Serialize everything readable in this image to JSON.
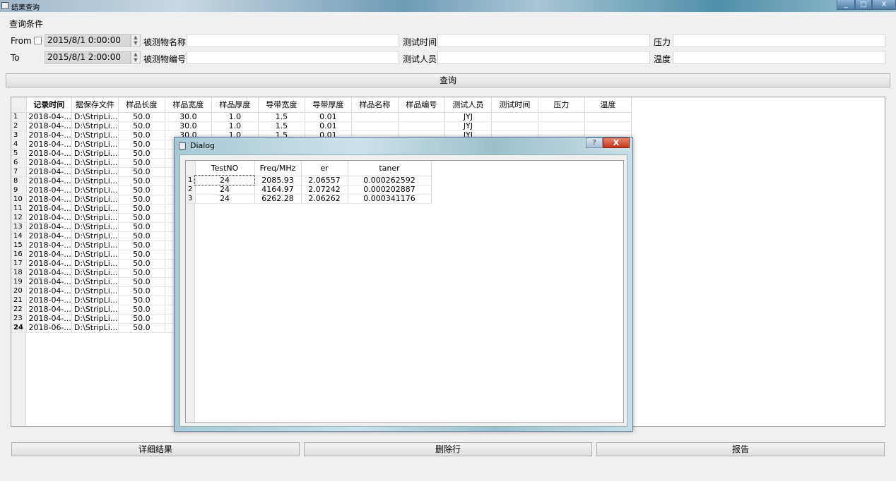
{
  "window": {
    "title": "结果查询",
    "min": "_",
    "max": "□",
    "close": "X"
  },
  "query": {
    "group_label": "查询条件",
    "from_label": "From",
    "to_label": "To",
    "from_value": "2015/8/1 0:00:00",
    "to_value": "2015/8/1 2:00:00",
    "name_label": "被测物名称",
    "id_label": "被测物编号",
    "time_label": "测试时间",
    "tester_label": "测试人员",
    "pressure_label": "压力",
    "temp_label": "温度",
    "search_button": "查询"
  },
  "table": {
    "headers": [
      "记录时间",
      "据保存文件",
      "样品长度",
      "样品宽度",
      "样品厚度",
      "导带宽度",
      "导带厚度",
      "样品名称",
      "样品编号",
      "测试人员",
      "测试时间",
      "压力",
      "温度"
    ],
    "rows": [
      {
        "n": "1",
        "time": "2018-04-...",
        "file": "D:\\StripLi...",
        "len": "50.0",
        "wid": "30.0",
        "thk": "1.0",
        "bw": "1.5",
        "bt": "0.01",
        "tester": "JYJ"
      },
      {
        "n": "2",
        "time": "2018-04-...",
        "file": "D:\\StripLi...",
        "len": "50.0",
        "wid": "30.0",
        "thk": "1.0",
        "bw": "1.5",
        "bt": "0.01",
        "tester": "JYJ"
      },
      {
        "n": "3",
        "time": "2018-04-...",
        "file": "D:\\StripLi...",
        "len": "50.0",
        "wid": "30.0",
        "thk": "1.0",
        "bw": "1.5",
        "bt": "0.01",
        "tester": "JYJ"
      },
      {
        "n": "4",
        "time": "2018-04-...",
        "file": "D:\\StripLi...",
        "len": "50.0"
      },
      {
        "n": "5",
        "time": "2018-04-...",
        "file": "D:\\StripLi...",
        "len": "50.0"
      },
      {
        "n": "6",
        "time": "2018-04-...",
        "file": "D:\\StripLi...",
        "len": "50.0"
      },
      {
        "n": "7",
        "time": "2018-04-...",
        "file": "D:\\StripLi...",
        "len": "50.0"
      },
      {
        "n": "8",
        "time": "2018-04-...",
        "file": "D:\\StripLi...",
        "len": "50.0"
      },
      {
        "n": "9",
        "time": "2018-04-...",
        "file": "D:\\StripLi...",
        "len": "50.0"
      },
      {
        "n": "10",
        "time": "2018-04-...",
        "file": "D:\\StripLi...",
        "len": "50.0"
      },
      {
        "n": "11",
        "time": "2018-04-...",
        "file": "D:\\StripLi...",
        "len": "50.0"
      },
      {
        "n": "12",
        "time": "2018-04-...",
        "file": "D:\\StripLi...",
        "len": "50.0"
      },
      {
        "n": "13",
        "time": "2018-04-...",
        "file": "D:\\StripLi...",
        "len": "50.0"
      },
      {
        "n": "14",
        "time": "2018-04-...",
        "file": "D:\\StripLi...",
        "len": "50.0"
      },
      {
        "n": "15",
        "time": "2018-04-...",
        "file": "D:\\StripLi...",
        "len": "50.0"
      },
      {
        "n": "16",
        "time": "2018-04-...",
        "file": "D:\\StripLi...",
        "len": "50.0"
      },
      {
        "n": "17",
        "time": "2018-04-...",
        "file": "D:\\StripLi...",
        "len": "50.0"
      },
      {
        "n": "18",
        "time": "2018-04-...",
        "file": "D:\\StripLi...",
        "len": "50.0"
      },
      {
        "n": "19",
        "time": "2018-04-...",
        "file": "D:\\StripLi...",
        "len": "50.0"
      },
      {
        "n": "20",
        "time": "2018-04-...",
        "file": "D:\\StripLi...",
        "len": "50.0"
      },
      {
        "n": "21",
        "time": "2018-04-...",
        "file": "D:\\StripLi...",
        "len": "50.0"
      },
      {
        "n": "22",
        "time": "2018-04-...",
        "file": "D:\\StripLi...",
        "len": "50.0"
      },
      {
        "n": "23",
        "time": "2018-04-...",
        "file": "D:\\StripLi...",
        "len": "50.0"
      },
      {
        "n": "24",
        "time": "2018-06-...",
        "file": "D:\\StripLi...",
        "len": "50.0"
      }
    ]
  },
  "dialog": {
    "title": "Dialog",
    "help": "?",
    "close": "X",
    "headers": [
      "TestNO",
      "Freq/MHz",
      "er",
      "taner"
    ],
    "rows": [
      {
        "n": "1",
        "testno": "24",
        "freq": "2085.93",
        "er": "2.06557",
        "taner": "0.000262592"
      },
      {
        "n": "2",
        "testno": "24",
        "freq": "4164.97",
        "er": "2.07242",
        "taner": "0.000202887"
      },
      {
        "n": "3",
        "testno": "24",
        "freq": "6262.28",
        "er": "2.06262",
        "taner": "0.000341176"
      }
    ]
  },
  "actions": {
    "detail": "详细结果",
    "delete": "删除行",
    "report": "报告"
  }
}
